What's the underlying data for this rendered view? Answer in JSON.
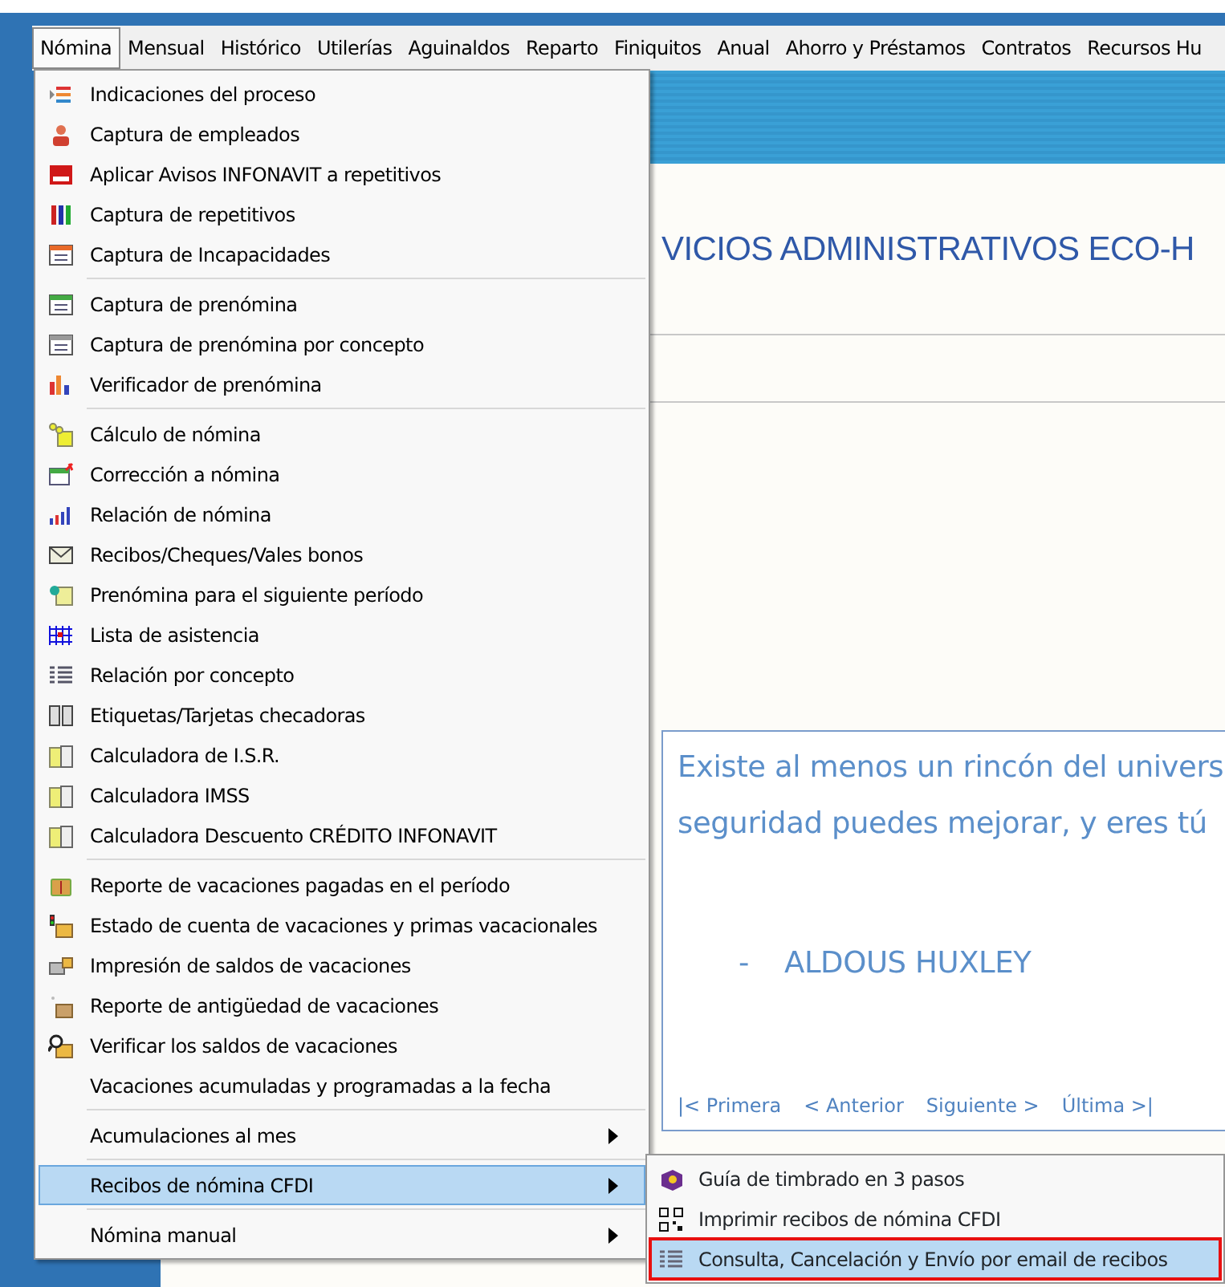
{
  "menubar": [
    {
      "label": "Nómina",
      "selected": true
    },
    {
      "label": "Mensual",
      "selected": false
    },
    {
      "label": "Histórico",
      "selected": false
    },
    {
      "label": "Utilerías",
      "selected": false
    },
    {
      "label": "Aguinaldos",
      "selected": false
    },
    {
      "label": "Reparto",
      "selected": false
    },
    {
      "label": "Finiquitos",
      "selected": false
    },
    {
      "label": "Anual",
      "selected": false
    },
    {
      "label": "Ahorro y Préstamos",
      "selected": false
    },
    {
      "label": "Contratos",
      "selected": false
    },
    {
      "label": "Recursos Hu",
      "selected": false
    }
  ],
  "company_title": "VICIOS ADMINISTRATIVOS ECO-H",
  "quote": {
    "lines": [
      "Existe al menos un rincón del univers",
      "seguridad puedes mejorar, y eres tú"
    ],
    "author_dash": "-",
    "author": "ALDOUS HUXLEY",
    "nav": [
      "|< Primera",
      "< Anterior",
      "Siguiente >",
      "Última >|"
    ]
  },
  "menu": {
    "groups": [
      [
        {
          "label": "Indicaciones del proceso",
          "submenu": false,
          "selected": false
        },
        {
          "label": "Captura de empleados",
          "submenu": false,
          "selected": false
        },
        {
          "label": "Aplicar Avisos  INFONAVIT a repetitivos",
          "submenu": false,
          "selected": false
        },
        {
          "label": "Captura de repetitivos",
          "submenu": false,
          "selected": false
        },
        {
          "label": "Captura de Incapacidades",
          "submenu": false,
          "selected": false
        }
      ],
      [
        {
          "label": "Captura de prenómina",
          "submenu": false,
          "selected": false
        },
        {
          "label": "Captura de prenómina por concepto",
          "submenu": false,
          "selected": false
        },
        {
          "label": "Verificador de prenómina",
          "submenu": false,
          "selected": false
        }
      ],
      [
        {
          "label": "Cálculo de nómina",
          "submenu": false,
          "selected": false
        },
        {
          "label": "Corrección a nómina",
          "submenu": false,
          "selected": false
        },
        {
          "label": "Relación de nómina",
          "submenu": false,
          "selected": false
        },
        {
          "label": "Recibos/Cheques/Vales bonos",
          "submenu": false,
          "selected": false
        },
        {
          "label": "Prenómina para el siguiente período",
          "submenu": false,
          "selected": false
        },
        {
          "label": "Lista de asistencia",
          "submenu": false,
          "selected": false
        },
        {
          "label": "Relación por concepto",
          "submenu": false,
          "selected": false
        },
        {
          "label": "Etiquetas/Tarjetas checadoras",
          "submenu": false,
          "selected": false
        },
        {
          "label": "Calculadora de I.S.R.",
          "submenu": false,
          "selected": false
        },
        {
          "label": "Calculadora IMSS",
          "submenu": false,
          "selected": false
        },
        {
          "label": "Calculadora Descuento CRÉDITO INFONAVIT",
          "submenu": false,
          "selected": false
        }
      ],
      [
        {
          "label": "Reporte de vacaciones pagadas en el período",
          "submenu": false,
          "selected": false
        },
        {
          "label": "Estado de cuenta de vacaciones y primas vacacionales",
          "submenu": false,
          "selected": false
        },
        {
          "label": "Impresión de saldos de vacaciones",
          "submenu": false,
          "selected": false
        },
        {
          "label": "Reporte de antigüedad de vacaciones",
          "submenu": false,
          "selected": false
        },
        {
          "label": "Verificar los saldos de vacaciones",
          "submenu": false,
          "selected": false
        },
        {
          "label": "Vacaciones acumuladas y programadas a la fecha",
          "submenu": false,
          "selected": false
        }
      ],
      [
        {
          "label": "Acumulaciones al mes",
          "submenu": true,
          "selected": false
        }
      ],
      [
        {
          "label": "Recibos de nómina CFDI",
          "submenu": true,
          "selected": true
        }
      ],
      [
        {
          "label": "Nómina manual",
          "submenu": true,
          "selected": false
        }
      ]
    ]
  },
  "submenu": [
    {
      "label": "Guía de timbrado en 3 pasos",
      "selected": false,
      "outlined": false
    },
    {
      "label": "Imprimir recibos de nómina CFDI",
      "selected": false,
      "outlined": false
    },
    {
      "label": "Consulta, Cancelación y Envío por email de recibos",
      "selected": true,
      "outlined": true
    }
  ]
}
